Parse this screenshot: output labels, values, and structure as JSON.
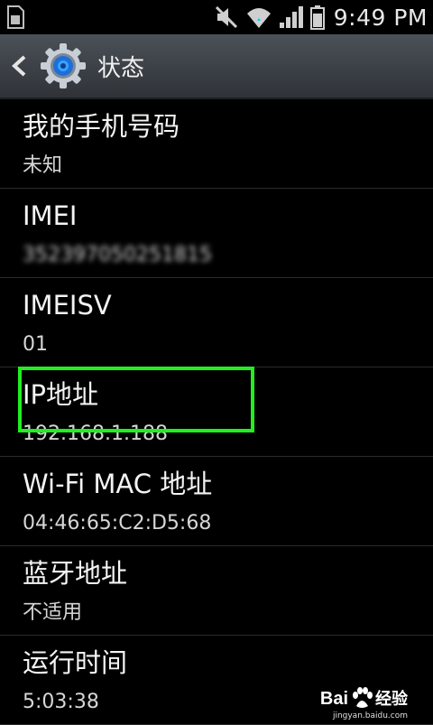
{
  "status_bar": {
    "time": "9:49 PM",
    "icons": [
      "sd-card-icon",
      "mute-icon",
      "wifi-icon",
      "signal-icon",
      "battery-icon"
    ]
  },
  "action_bar": {
    "title": "状态",
    "icon": "settings-gear-icon"
  },
  "items": [
    {
      "title": "我的手机号码",
      "value": "未知"
    },
    {
      "title": "IMEI",
      "value": "352397050251815"
    },
    {
      "title": "IMEISV",
      "value": "01"
    },
    {
      "title": "IP地址",
      "value": "192.168.1.188"
    },
    {
      "title": "Wi-Fi MAC 地址",
      "value": "04:46:65:C2:D5:68"
    },
    {
      "title": "蓝牙地址",
      "value": "不适用"
    },
    {
      "title": "运行时间",
      "value": "5:03:38"
    }
  ],
  "watermark": {
    "logo": "Bai",
    "text": "经验",
    "url": "jingyan.baidu.com"
  },
  "colors": {
    "highlight": "#22ee22",
    "background": "#000000"
  }
}
